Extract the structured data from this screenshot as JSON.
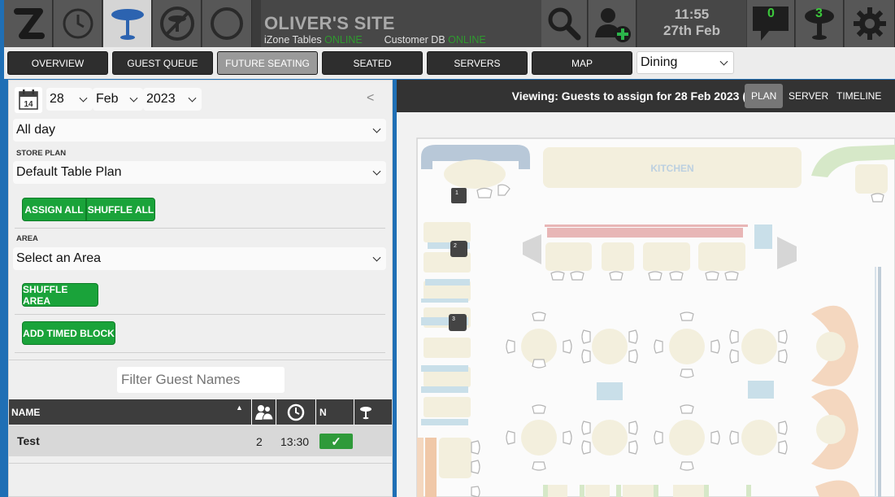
{
  "header": {
    "site_title": "OLIVER'S SITE",
    "izone_label": "iZone Tables",
    "izone_status": "ONLINE",
    "customer_label": "Customer DB",
    "customer_status": "ONLINE",
    "time": "11:55",
    "date": "27th Feb",
    "message_count": "0",
    "table_count": "3",
    "accent_online": "#2f9a2f"
  },
  "nav": {
    "tabs": [
      "OVERVIEW",
      "GUEST QUEUE",
      "FUTURE SEATING",
      "SEATED",
      "SERVERS",
      "MAP"
    ],
    "active_tab": "FUTURE SEATING",
    "area_select": "Dining"
  },
  "panel": {
    "day": "28",
    "month": "Feb",
    "year": "2023",
    "collapse": "<",
    "time_range": "All day",
    "store_plan_label": "STORE PLAN",
    "store_plan": "Default Table Plan",
    "assign_all": "ASSIGN ALL",
    "shuffle_all": "SHUFFLE ALL",
    "area_label": "AREA",
    "area": "Select an Area",
    "shuffle_area": "SHUFFLE AREA",
    "add_timed_block": "ADD TIMED BLOCK",
    "filter_placeholder": "Filter Guest Names",
    "columns": {
      "name": "NAME",
      "n": "N"
    },
    "guests": [
      {
        "name": "Test",
        "party": "2",
        "time": "13:30",
        "confirmed": "✓"
      }
    ]
  },
  "plan": {
    "viewing_text": "Viewing: Guests to assign for 28 Feb 2023 (",
    "tabs": [
      "PLAN",
      "SERVER",
      "TIMELINE"
    ],
    "active_tab": "PLAN",
    "kitchen_label": "KITCHEN",
    "table_numbers": [
      "1",
      "2",
      "3"
    ]
  }
}
